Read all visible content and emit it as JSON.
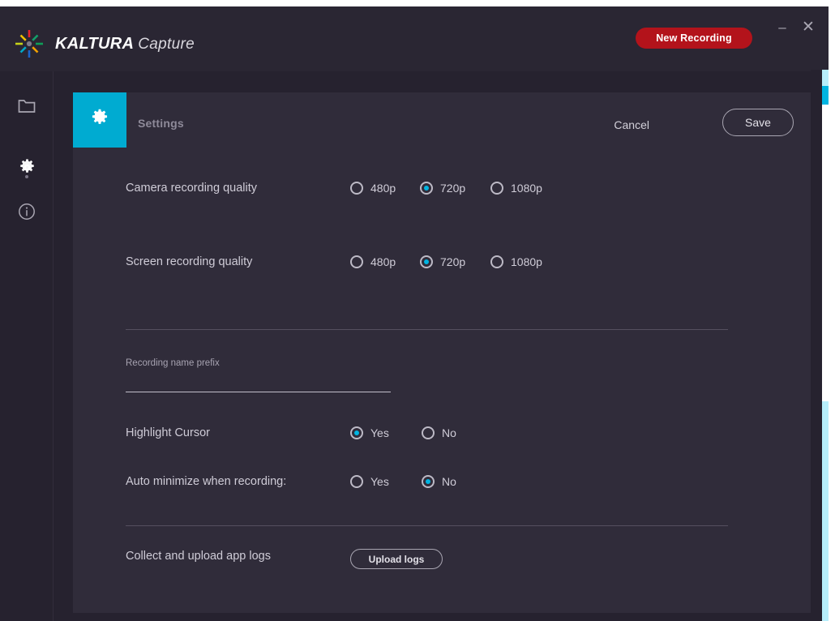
{
  "window": {
    "brand_name": "KALTURA",
    "brand_product": "Capture",
    "logo_icon": "kaltura-starburst-icon",
    "new_recording_label": "New Recording",
    "minimize_label": "–",
    "close_label": "✕",
    "accent_red": "#b3131b",
    "accent_cyan": "#00b5e2",
    "titlebar_bg": "#2a2633",
    "panel_bg": "#302c3a"
  },
  "sidebar": {
    "items": [
      {
        "name": "library",
        "icon": "folder-icon",
        "active": false
      },
      {
        "name": "settings",
        "icon": "gear-icon",
        "active": true
      },
      {
        "name": "about",
        "icon": "info-circle-icon",
        "active": false
      }
    ]
  },
  "settings_panel": {
    "icon": "gear-icon",
    "title": "Settings",
    "cancel_label": "Cancel",
    "save_label": "Save",
    "rows": [
      {
        "label": "Camera recording quality",
        "type": "radio",
        "options": [
          {
            "label": "480p",
            "selected": false
          },
          {
            "label": "720p",
            "selected": true
          },
          {
            "label": "1080p",
            "selected": false
          }
        ]
      },
      {
        "label": "Screen recording quality",
        "type": "radio",
        "options": [
          {
            "label": "480p",
            "selected": false
          },
          {
            "label": "720p",
            "selected": true
          },
          {
            "label": "1080p",
            "selected": false
          }
        ]
      },
      {
        "label": "Highlight Cursor",
        "type": "radio",
        "options": [
          {
            "label": "Yes",
            "selected": true
          },
          {
            "label": "No",
            "selected": false
          }
        ]
      },
      {
        "label": "Auto minimize when recording:",
        "type": "radio",
        "options": [
          {
            "label": "Yes",
            "selected": false
          },
          {
            "label": "No",
            "selected": true
          }
        ]
      },
      {
        "label": "Collect and upload app logs",
        "type": "button",
        "button_label": "Upload logs"
      }
    ],
    "prefix_field": {
      "label": "Recording name prefix",
      "value": "",
      "placeholder": ""
    }
  },
  "scrollbar": {
    "thumb_color": "#00b5e2",
    "track_color": "#b7eefb"
  }
}
